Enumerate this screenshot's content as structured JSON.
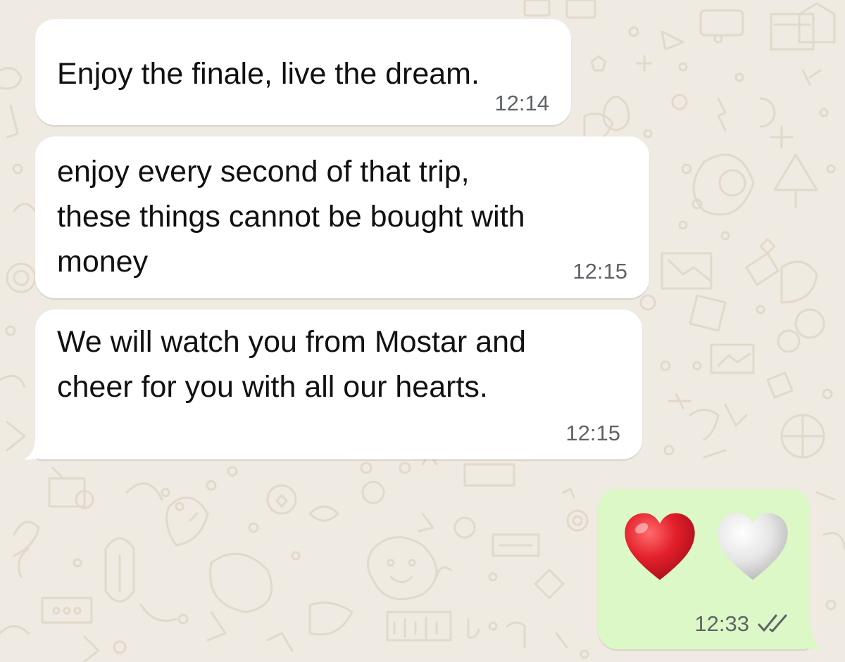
{
  "theme": {
    "wallpaper": "#efeae2",
    "doodle": "#e2d9cb",
    "incoming_bubble": "#ffffff",
    "outgoing_bubble": "#dcf8c6",
    "time_color": "#5f6368",
    "heart_red": "#e3202c",
    "heart_white": "#e6e6e6"
  },
  "messages": [
    {
      "direction": "incoming",
      "text": "Enjoy the finale, live the dream.",
      "time": "12:14"
    },
    {
      "direction": "incoming",
      "text": "enjoy every second of that trip,\nthese things cannot be bought with\nmoney",
      "time": "12:15"
    },
    {
      "direction": "incoming",
      "text": "We will watch you from Mostar and\ncheer for you with all our hearts.",
      "time": "12:15"
    },
    {
      "direction": "outgoing",
      "emojis": [
        "red-heart-emoji",
        "white-heart-emoji"
      ],
      "time": "12:33",
      "status": "read-double-check"
    }
  ]
}
